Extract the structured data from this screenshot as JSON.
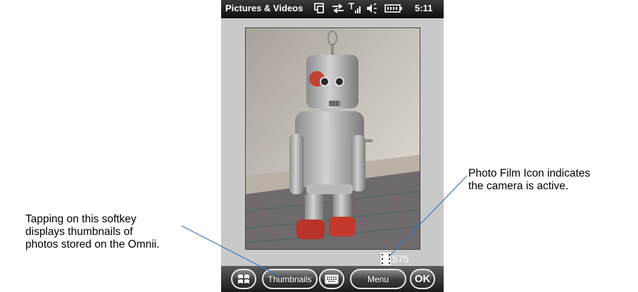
{
  "status_bar": {
    "app_title": "Pictures & Videos",
    "time": "5:11",
    "icons": [
      "sync-icon",
      "connectivity-icon",
      "signal-icon",
      "volume-icon",
      "battery-icon"
    ]
  },
  "viewer": {
    "photo_counter": "575",
    "photo_description": "tin toy robot"
  },
  "softkeys": {
    "start": "start-icon",
    "thumbnails": "Thumbnails",
    "keyboard": "keyboard-icon",
    "menu": "Menu",
    "ok": "OK"
  },
  "annotations": {
    "left": [
      "Tapping on this softkey",
      "displays thumbnails of",
      "photos stored on the Omnii."
    ],
    "right": [
      "Photo Film Icon indicates",
      "the camera is active."
    ]
  },
  "colors": {
    "annotation_line": "#3a7abf",
    "status_bar": "#1a1a1a",
    "softkey_bar": "#2a2a2a",
    "viewer_bg": "#c9c9c9"
  }
}
